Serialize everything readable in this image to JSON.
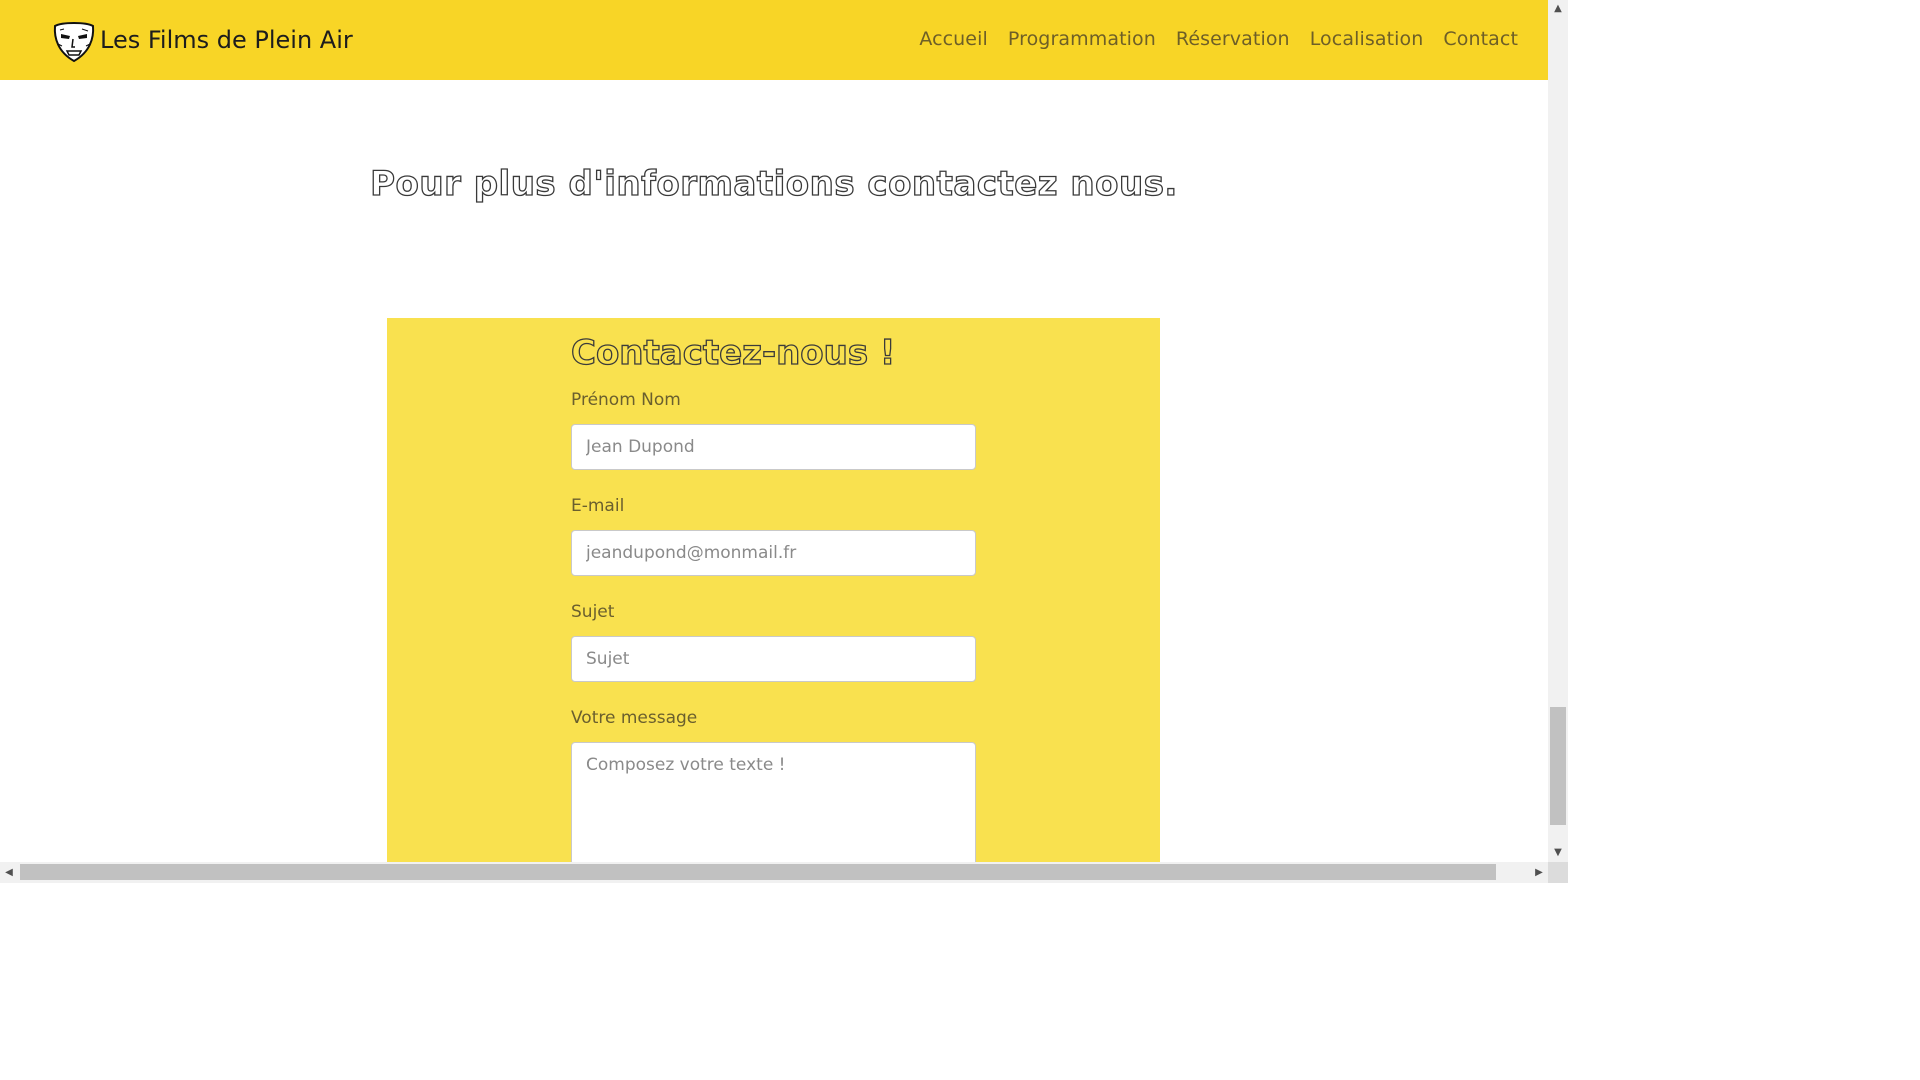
{
  "navbar": {
    "brand": "Les Films de Plein Air",
    "logo_icon": "mask-logo-icon",
    "links": [
      "Accueil",
      "Programmation",
      "Réservation",
      "Localisation",
      "Contact"
    ],
    "background": "#f8d526"
  },
  "main": {
    "headline": "Pour plus d'informations contactez nous."
  },
  "contact_form": {
    "title": "Contactez-nous !",
    "background": "#f9e14f",
    "fields": {
      "name": {
        "label": "Prénom Nom",
        "placeholder": "Jean Dupond",
        "value": ""
      },
      "email": {
        "label": "E-mail",
        "placeholder": "jeandupond@monmail.fr",
        "value": ""
      },
      "subject": {
        "label": "Sujet",
        "placeholder": "Sujet",
        "value": ""
      },
      "message": {
        "label": "Votre message",
        "placeholder": "Composez votre texte !",
        "value": ""
      }
    }
  }
}
